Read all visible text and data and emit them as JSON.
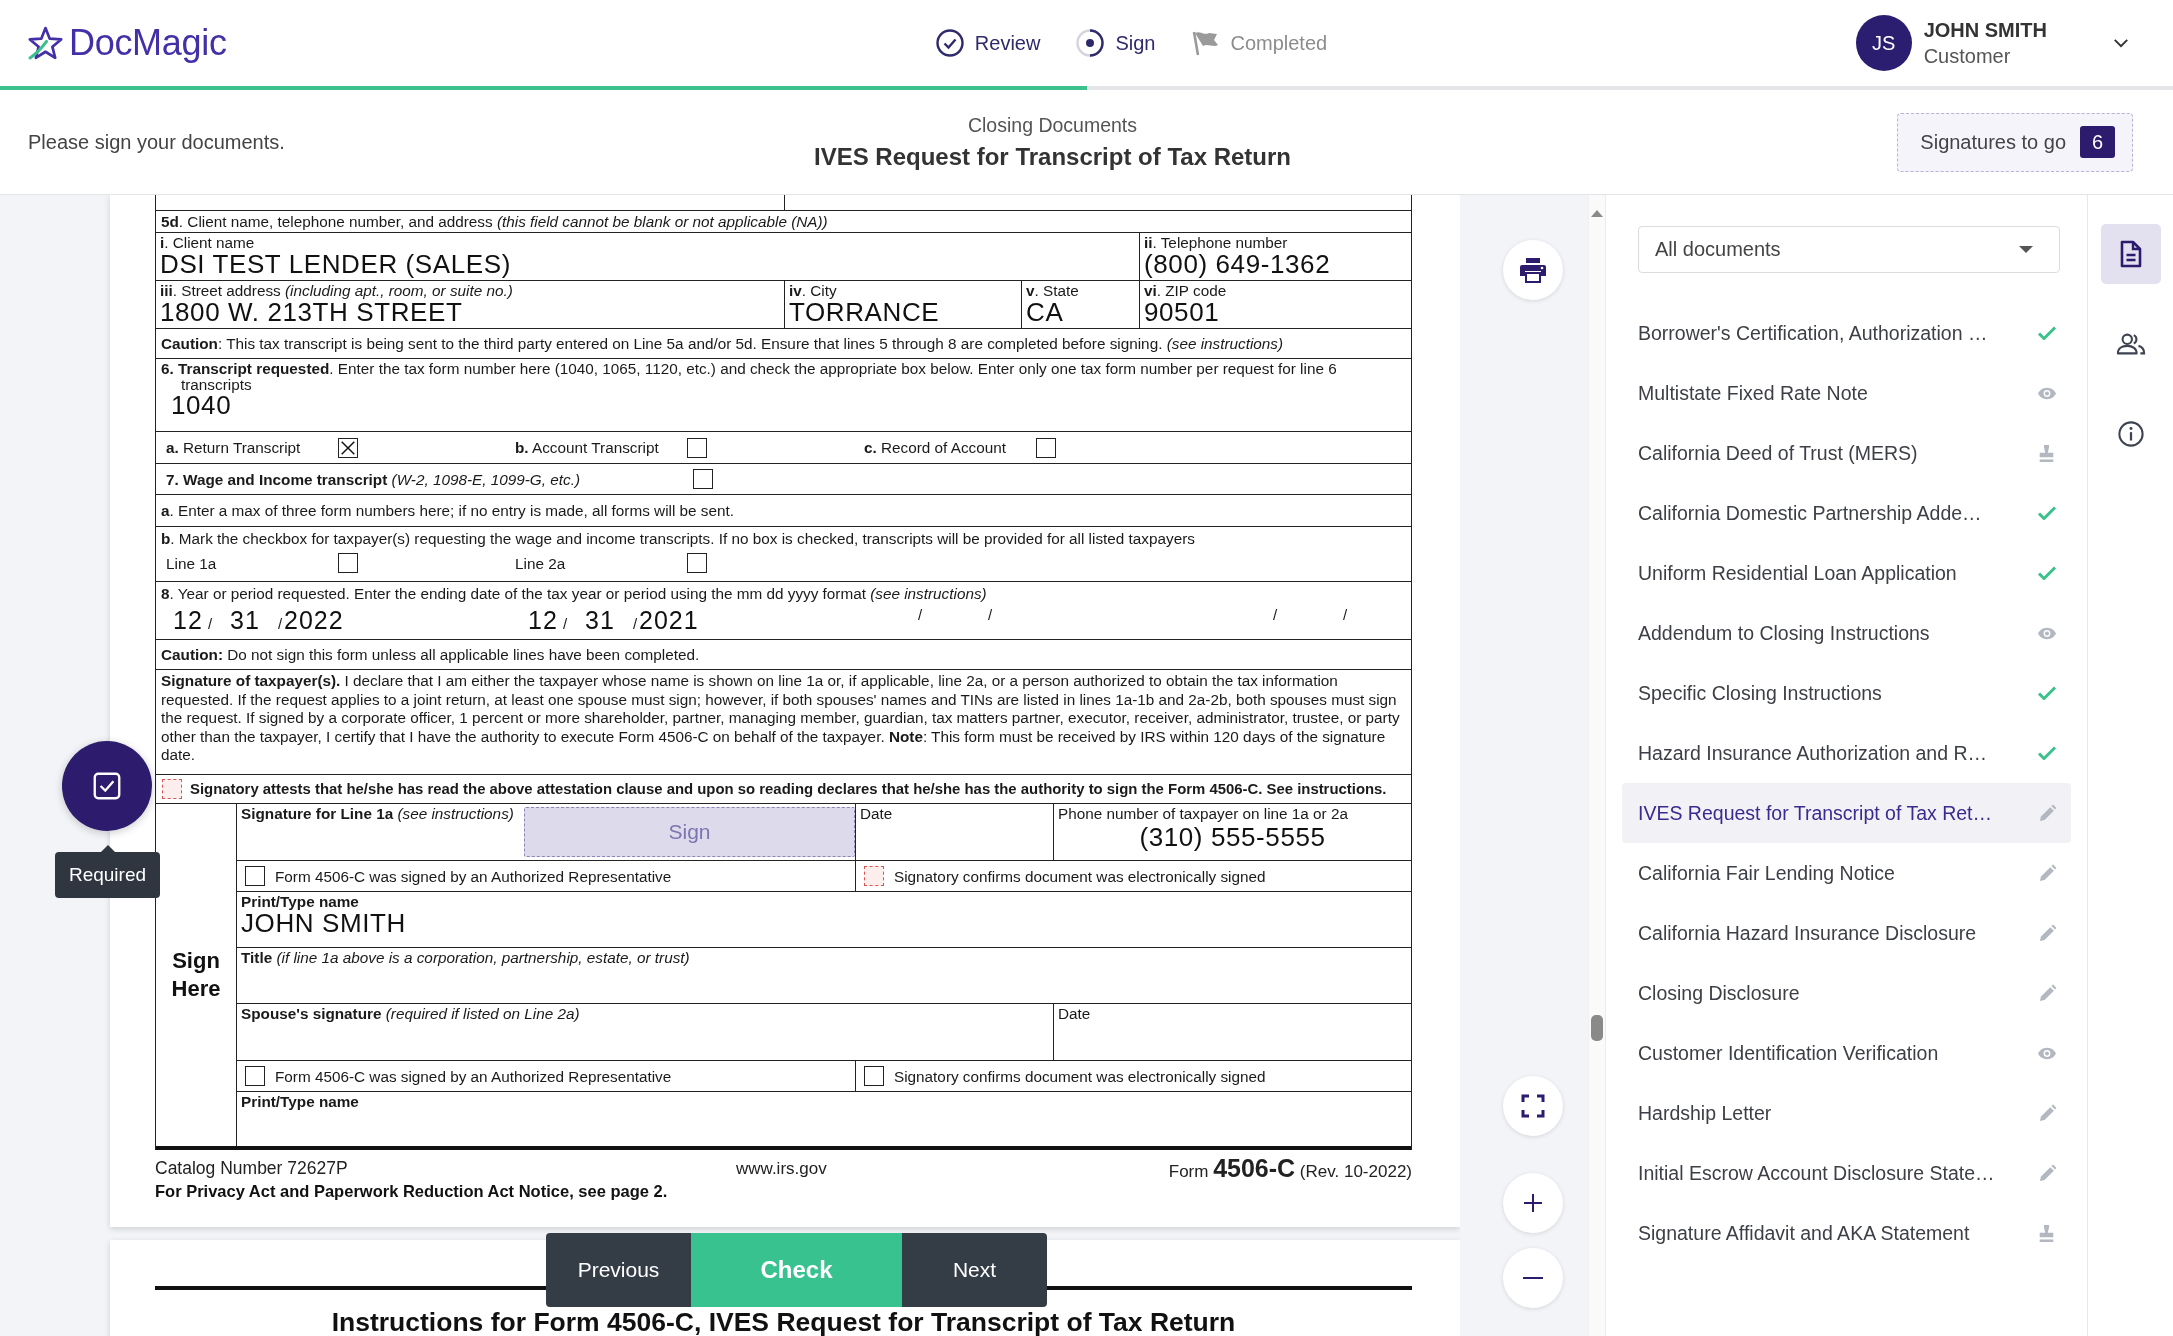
{
  "brand": {
    "name": "DocMagic"
  },
  "steps": [
    {
      "label": "Review",
      "kind": "done"
    },
    {
      "label": "Sign",
      "kind": "current"
    },
    {
      "label": "Completed",
      "kind": "pending"
    }
  ],
  "user": {
    "initials": "JS",
    "name": "JOHN SMITH",
    "role": "Customer"
  },
  "progress": {
    "level": 0.5
  },
  "subheader": {
    "instruction": "Please sign your documents.",
    "group": "Closing Documents",
    "title": "IVES Request for Transcript of Tax Return",
    "signatures_label": "Signatures to go",
    "signatures_count": "6"
  },
  "form": {
    "line_5d": "**5d**. Client name, telephone number, and address *(this field cannot be blank or not applicable (NA))*",
    "client_name": {
      "label": "**i**. Client name",
      "value": "DSI TEST LENDER (SALES)"
    },
    "telephone": {
      "label": "**ii**. Telephone number",
      "value": "(800) 649-1362"
    },
    "street": {
      "label": "**iii**. Street address *(including apt., room, or suite no.)*",
      "value": "1800 W. 213TH STREET"
    },
    "city": {
      "label": "**iv**. City",
      "value": "TORRANCE"
    },
    "state": {
      "label": "**v**. State",
      "value": "CA"
    },
    "zip": {
      "label": "**vi**. ZIP code",
      "value": "90501"
    },
    "caution_1": "**Caution**: This tax transcript is being sent to the third party entered on Line 5a and/or 5d. Ensure that lines 5 through 8 are completed before signing. *(see instructions)*",
    "line_6": {
      "text": "**6. Transcript requested**. Enter the tax form number here (1040, 1065, 1120, etc.) and check the appropriate box below. Enter only one tax form number per request for line 6 transcripts",
      "value": "1040"
    },
    "transcript_options": [
      {
        "label": "**a.** Return Transcript",
        "checked": true
      },
      {
        "label": "**b.** Account Transcript",
        "checked": false
      },
      {
        "label": "**c.** Record of Account",
        "checked": false
      }
    ],
    "line_7": {
      "label": "**7. Wage and Income transcript** *(W-2, 1098-E, 1099-G, etc.)*",
      "checked": false
    },
    "line_7a": "**a**. Enter a max of three form numbers here; if no entry is made, all forms will be sent.",
    "line_7b": {
      "text": "**b**. Mark the checkbox for taxpayer(s) requesting the wage and income transcripts. If no box is checked, transcripts will be provided for all listed taxpayers",
      "options": [
        {
          "label": "Line 1a",
          "checked": false
        },
        {
          "label": "Line 2a",
          "checked": false
        }
      ]
    },
    "line_8": {
      "text": "**8**. Year or period requested. Enter the ending date of the tax year or period using the mm dd yyyy format *(see instructions)*",
      "dates": [
        {
          "month": "12",
          "sep_1": "/",
          "day": "31",
          "sep_2": "/",
          "year": "2022"
        },
        {
          "month": "12",
          "sep_1": "/",
          "day": "31",
          "sep_2": "/",
          "year": "2021"
        },
        {
          "sep_1": "/",
          "sep_2": "/"
        },
        {
          "sep_1": "/",
          "sep_2": "/"
        }
      ]
    },
    "caution_2": "**Caution:** Do not sign this form unless all applicable lines have been completed.",
    "declaration": "**Signature of taxpayer(s).** I declare that I am either the taxpayer whose name is shown on line 1a or, if applicable, line 2a, or a person authorized to obtain the tax information requested. If the request applies to a joint return, at least one spouse must sign; however, if both spouses' names and TINs are listed in lines 1a-1b and 2a-2b, both spouses must sign the request. If signed by a corporate officer, 1 percent or more shareholder, partner, managing member, guardian, tax matters partner, executor, receiver, administrator, trustee, or party other than the taxpayer, I certify that I have the authority to execute Form 4506-C on behalf of the taxpayer. **Note**: This form must be received by IRS within 120 days of the signature date.",
    "attestation": {
      "text": "Signatory attests that he/she has read the above attestation clause and upon so reading declares that he/she has the authority to sign the Form 4506-C. See instructions.",
      "checked": false,
      "required": true
    },
    "sign_here": "Sign Here",
    "signature_1": {
      "label": "**Signature for Line 1a** *(see instructions)*",
      "button": "Sign",
      "date_label": "Date",
      "phone_label": "Phone number of taxpayer on line 1a or 2a",
      "phone": "(310) 555-5555"
    },
    "representative_1": {
      "label": "Form 4506-C was signed by an Authorized Representative",
      "checked": false,
      "required": false
    },
    "electronic_1": {
      "label": "Signatory confirms document was electronically signed",
      "checked": false,
      "required": true
    },
    "print_name_1": {
      "label": "Print/Type name",
      "value": "JOHN SMITH"
    },
    "title": "**Title** *(if line 1a above is a corporation, partnership, estate, or trust)*",
    "spouse_signature": {
      "label": "**Spouse's signature** *(required if listed on Line 2a)*",
      "date_label": "Date"
    },
    "representative_2": {
      "label": "Form 4506-C was signed by an Authorized Representative",
      "checked": false,
      "required": false
    },
    "electronic_2": {
      "label": "Signatory confirms document was electronically signed",
      "checked": false,
      "required": false
    },
    "print_name_2": {
      "label": "Print/Type name"
    },
    "catalog": "Catalog Number 72627P",
    "privacy": "For Privacy Act and Paperwork Reduction Act Notice, see page 2.",
    "website": "www.irs.gov",
    "form_number": "Form **4506-C** (Rev. 10-2022)"
  },
  "page_2": {
    "heading": "Instructions for Form 4506-C, IVES Request for Transcript of Tax Return"
  },
  "field_hint": {
    "label": "Required"
  },
  "navigation": [
    {
      "label": "Previous",
      "primary": false
    },
    {
      "label": "Check",
      "primary": true
    },
    {
      "label": "Next",
      "primary": false
    }
  ],
  "sidebar": {
    "filter": "All documents",
    "documents": [
      {
        "name": "Borrower's Certification, Authorization …",
        "kind": "done",
        "selected": false
      },
      {
        "name": "Multistate Fixed Rate Note",
        "kind": "view",
        "selected": false
      },
      {
        "name": "California Deed of Trust (MERS)",
        "kind": "stamp",
        "selected": false
      },
      {
        "name": "California Domestic Partnership Adde…",
        "kind": "done",
        "selected": false
      },
      {
        "name": "Uniform Residential Loan Application",
        "kind": "done",
        "selected": false
      },
      {
        "name": "Addendum to Closing Instructions",
        "kind": "view",
        "selected": false
      },
      {
        "name": "Specific Closing Instructions",
        "kind": "done",
        "selected": false
      },
      {
        "name": "Hazard Insurance Authorization and R…",
        "kind": "done",
        "selected": false
      },
      {
        "name": "IVES Request for Transcript of Tax Ret…",
        "kind": "sign",
        "selected": true
      },
      {
        "name": "California Fair Lending Notice",
        "kind": "sign",
        "selected": false
      },
      {
        "name": "California Hazard Insurance Disclosure",
        "kind": "sign",
        "selected": false
      },
      {
        "name": "Closing Disclosure",
        "kind": "sign",
        "selected": false
      },
      {
        "name": "Customer Identification Verification",
        "kind": "view",
        "selected": false
      },
      {
        "name": "Hardship Letter",
        "kind": "sign",
        "selected": false
      },
      {
        "name": "Initial Escrow Account Disclosure State…",
        "kind": "sign",
        "selected": false
      },
      {
        "name": "Signature Affidavit and AKA Statement",
        "kind": "stamp",
        "selected": false
      }
    ]
  },
  "rail": [
    {
      "kind": "documents",
      "selected": true
    },
    {
      "kind": "people",
      "selected": false
    },
    {
      "kind": "info",
      "selected": false
    }
  ]
}
